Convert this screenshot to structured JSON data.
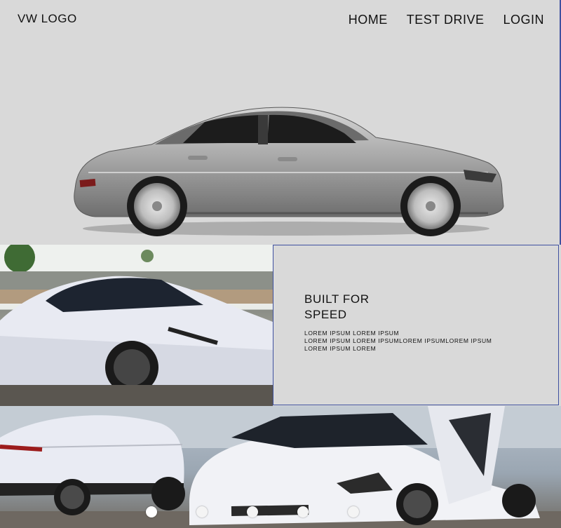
{
  "header": {
    "logo": "VW LOGO",
    "nav": [
      {
        "label": "HOME"
      },
      {
        "label": "TEST DRIVE"
      },
      {
        "label": "LOGIN"
      }
    ]
  },
  "feature": {
    "title": "BUILT FOR\nSPEED",
    "body": "LOREM IPSUM LOREM IPSUM\nLOREM IPSUM LOREM IPSUMLOREM IPSUMLOREM IPSUM\nLOREM IPSUM LOREM"
  },
  "carousel": {
    "slide_count": 6,
    "active_index": 0
  },
  "colors": {
    "page_bg": "#d9d9d9",
    "border_accent": "#3f51a0",
    "car_silver": "#a8a8a8",
    "car_white": "#eef0f6"
  }
}
